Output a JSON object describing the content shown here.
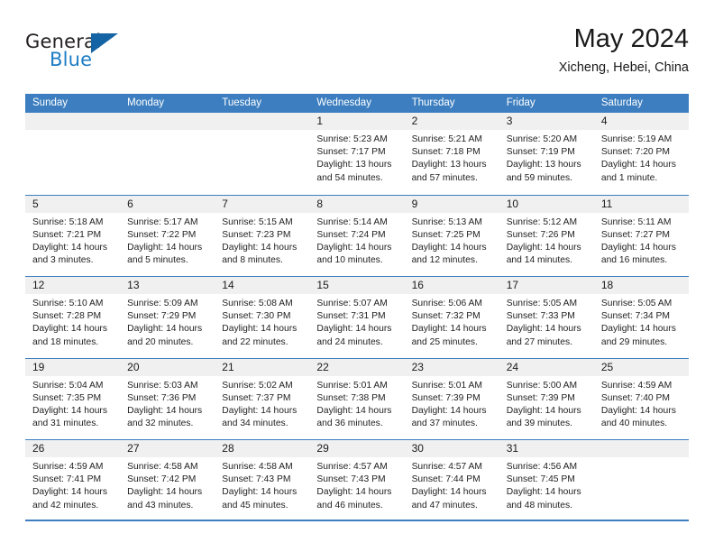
{
  "logo": {
    "word_top": "General",
    "word_bottom": "Blue",
    "triangle_color": "#1464a5",
    "blue_color": "#1d7cc4"
  },
  "header": {
    "title": "May 2024",
    "subtitle": "Xicheng, Hebei, China"
  },
  "theme": {
    "accent": "#3c7ebf",
    "day_band": "#f0f0f0",
    "text": "#222222"
  },
  "calendar": {
    "weekday_headers": [
      "Sunday",
      "Monday",
      "Tuesday",
      "Wednesday",
      "Thursday",
      "Friday",
      "Saturday"
    ],
    "weeks": [
      [
        {
          "day": "",
          "lines": []
        },
        {
          "day": "",
          "lines": []
        },
        {
          "day": "",
          "lines": []
        },
        {
          "day": "1",
          "lines": [
            "Sunrise: 5:23 AM",
            "Sunset: 7:17 PM",
            "Daylight: 13 hours",
            "and 54 minutes."
          ]
        },
        {
          "day": "2",
          "lines": [
            "Sunrise: 5:21 AM",
            "Sunset: 7:18 PM",
            "Daylight: 13 hours",
            "and 57 minutes."
          ]
        },
        {
          "day": "3",
          "lines": [
            "Sunrise: 5:20 AM",
            "Sunset: 7:19 PM",
            "Daylight: 13 hours",
            "and 59 minutes."
          ]
        },
        {
          "day": "4",
          "lines": [
            "Sunrise: 5:19 AM",
            "Sunset: 7:20 PM",
            "Daylight: 14 hours",
            "and 1 minute."
          ]
        }
      ],
      [
        {
          "day": "5",
          "lines": [
            "Sunrise: 5:18 AM",
            "Sunset: 7:21 PM",
            "Daylight: 14 hours",
            "and 3 minutes."
          ]
        },
        {
          "day": "6",
          "lines": [
            "Sunrise: 5:17 AM",
            "Sunset: 7:22 PM",
            "Daylight: 14 hours",
            "and 5 minutes."
          ]
        },
        {
          "day": "7",
          "lines": [
            "Sunrise: 5:15 AM",
            "Sunset: 7:23 PM",
            "Daylight: 14 hours",
            "and 8 minutes."
          ]
        },
        {
          "day": "8",
          "lines": [
            "Sunrise: 5:14 AM",
            "Sunset: 7:24 PM",
            "Daylight: 14 hours",
            "and 10 minutes."
          ]
        },
        {
          "day": "9",
          "lines": [
            "Sunrise: 5:13 AM",
            "Sunset: 7:25 PM",
            "Daylight: 14 hours",
            "and 12 minutes."
          ]
        },
        {
          "day": "10",
          "lines": [
            "Sunrise: 5:12 AM",
            "Sunset: 7:26 PM",
            "Daylight: 14 hours",
            "and 14 minutes."
          ]
        },
        {
          "day": "11",
          "lines": [
            "Sunrise: 5:11 AM",
            "Sunset: 7:27 PM",
            "Daylight: 14 hours",
            "and 16 minutes."
          ]
        }
      ],
      [
        {
          "day": "12",
          "lines": [
            "Sunrise: 5:10 AM",
            "Sunset: 7:28 PM",
            "Daylight: 14 hours",
            "and 18 minutes."
          ]
        },
        {
          "day": "13",
          "lines": [
            "Sunrise: 5:09 AM",
            "Sunset: 7:29 PM",
            "Daylight: 14 hours",
            "and 20 minutes."
          ]
        },
        {
          "day": "14",
          "lines": [
            "Sunrise: 5:08 AM",
            "Sunset: 7:30 PM",
            "Daylight: 14 hours",
            "and 22 minutes."
          ]
        },
        {
          "day": "15",
          "lines": [
            "Sunrise: 5:07 AM",
            "Sunset: 7:31 PM",
            "Daylight: 14 hours",
            "and 24 minutes."
          ]
        },
        {
          "day": "16",
          "lines": [
            "Sunrise: 5:06 AM",
            "Sunset: 7:32 PM",
            "Daylight: 14 hours",
            "and 25 minutes."
          ]
        },
        {
          "day": "17",
          "lines": [
            "Sunrise: 5:05 AM",
            "Sunset: 7:33 PM",
            "Daylight: 14 hours",
            "and 27 minutes."
          ]
        },
        {
          "day": "18",
          "lines": [
            "Sunrise: 5:05 AM",
            "Sunset: 7:34 PM",
            "Daylight: 14 hours",
            "and 29 minutes."
          ]
        }
      ],
      [
        {
          "day": "19",
          "lines": [
            "Sunrise: 5:04 AM",
            "Sunset: 7:35 PM",
            "Daylight: 14 hours",
            "and 31 minutes."
          ]
        },
        {
          "day": "20",
          "lines": [
            "Sunrise: 5:03 AM",
            "Sunset: 7:36 PM",
            "Daylight: 14 hours",
            "and 32 minutes."
          ]
        },
        {
          "day": "21",
          "lines": [
            "Sunrise: 5:02 AM",
            "Sunset: 7:37 PM",
            "Daylight: 14 hours",
            "and 34 minutes."
          ]
        },
        {
          "day": "22",
          "lines": [
            "Sunrise: 5:01 AM",
            "Sunset: 7:38 PM",
            "Daylight: 14 hours",
            "and 36 minutes."
          ]
        },
        {
          "day": "23",
          "lines": [
            "Sunrise: 5:01 AM",
            "Sunset: 7:39 PM",
            "Daylight: 14 hours",
            "and 37 minutes."
          ]
        },
        {
          "day": "24",
          "lines": [
            "Sunrise: 5:00 AM",
            "Sunset: 7:39 PM",
            "Daylight: 14 hours",
            "and 39 minutes."
          ]
        },
        {
          "day": "25",
          "lines": [
            "Sunrise: 4:59 AM",
            "Sunset: 7:40 PM",
            "Daylight: 14 hours",
            "and 40 minutes."
          ]
        }
      ],
      [
        {
          "day": "26",
          "lines": [
            "Sunrise: 4:59 AM",
            "Sunset: 7:41 PM",
            "Daylight: 14 hours",
            "and 42 minutes."
          ]
        },
        {
          "day": "27",
          "lines": [
            "Sunrise: 4:58 AM",
            "Sunset: 7:42 PM",
            "Daylight: 14 hours",
            "and 43 minutes."
          ]
        },
        {
          "day": "28",
          "lines": [
            "Sunrise: 4:58 AM",
            "Sunset: 7:43 PM",
            "Daylight: 14 hours",
            "and 45 minutes."
          ]
        },
        {
          "day": "29",
          "lines": [
            "Sunrise: 4:57 AM",
            "Sunset: 7:43 PM",
            "Daylight: 14 hours",
            "and 46 minutes."
          ]
        },
        {
          "day": "30",
          "lines": [
            "Sunrise: 4:57 AM",
            "Sunset: 7:44 PM",
            "Daylight: 14 hours",
            "and 47 minutes."
          ]
        },
        {
          "day": "31",
          "lines": [
            "Sunrise: 4:56 AM",
            "Sunset: 7:45 PM",
            "Daylight: 14 hours",
            "and 48 minutes."
          ]
        },
        {
          "day": "",
          "lines": []
        }
      ]
    ]
  }
}
